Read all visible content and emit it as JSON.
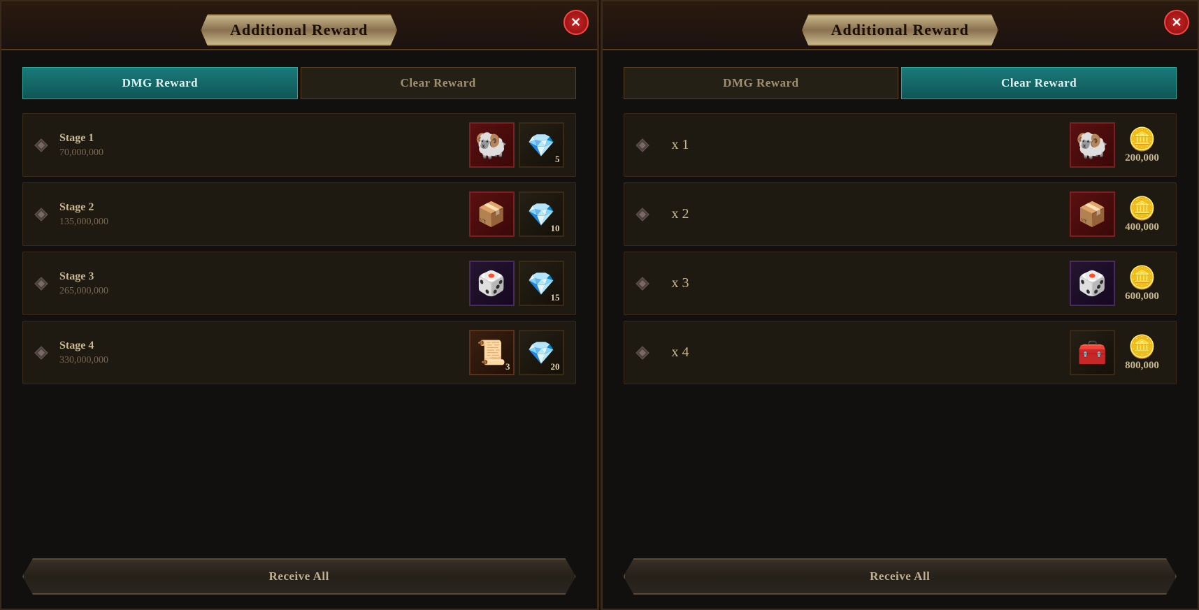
{
  "left_panel": {
    "title": "Additional Reward",
    "close_label": "✕",
    "tabs": [
      {
        "id": "dmg",
        "label": "DMG Reward",
        "active": true
      },
      {
        "id": "clear",
        "label": "Clear Reward",
        "active": false
      }
    ],
    "stages": [
      {
        "name": "Stage 1",
        "score": "70,000,000",
        "items": [
          {
            "type": "skull",
            "bg": "red-bg",
            "count": ""
          },
          {
            "type": "gem",
            "bg": "dark-bg",
            "count": "5"
          }
        ]
      },
      {
        "name": "Stage 2",
        "score": "135,000,000",
        "items": [
          {
            "type": "chest",
            "bg": "red-bg",
            "count": ""
          },
          {
            "type": "gem",
            "bg": "dark-bg",
            "count": "10"
          }
        ]
      },
      {
        "name": "Stage 3",
        "score": "265,000,000",
        "items": [
          {
            "type": "cube",
            "bg": "purple-bg",
            "count": ""
          },
          {
            "type": "gem",
            "bg": "dark-bg",
            "count": "15"
          }
        ]
      },
      {
        "name": "Stage 4",
        "score": "330,000,000",
        "items": [
          {
            "type": "scroll",
            "bg": "brown-bg",
            "count": "3"
          },
          {
            "type": "gem",
            "bg": "dark-bg",
            "count": "20"
          }
        ]
      }
    ],
    "receive_all_label": "Receive All"
  },
  "right_panel": {
    "title": "Additional Reward",
    "close_label": "✕",
    "tabs": [
      {
        "id": "dmg",
        "label": "DMG Reward",
        "active": false
      },
      {
        "id": "clear",
        "label": "Clear Reward",
        "active": true
      }
    ],
    "clear_rows": [
      {
        "multiplier": "x 1",
        "items": [
          {
            "type": "skull",
            "bg": "red-bg"
          },
          {
            "type": "gold",
            "amount": "200,000"
          }
        ]
      },
      {
        "multiplier": "x 2",
        "items": [
          {
            "type": "chest",
            "bg": "red-bg"
          },
          {
            "type": "gold",
            "amount": "400,000"
          }
        ]
      },
      {
        "multiplier": "x 3",
        "items": [
          {
            "type": "cube",
            "bg": "purple-bg"
          },
          {
            "type": "gold",
            "amount": "600,000"
          }
        ]
      },
      {
        "multiplier": "x 4",
        "items": [
          {
            "type": "chest2",
            "bg": "dark-bg"
          },
          {
            "type": "gold",
            "amount": "800,000"
          }
        ]
      }
    ],
    "receive_all_label": "Receive All"
  },
  "icons": {
    "skull": "🐏",
    "gem": "💎",
    "chest": "📦",
    "chest2": "🧰",
    "cube": "🎲",
    "scroll": "📜",
    "gold": "🪙",
    "close": "✕",
    "diamond_marker": "❖"
  }
}
